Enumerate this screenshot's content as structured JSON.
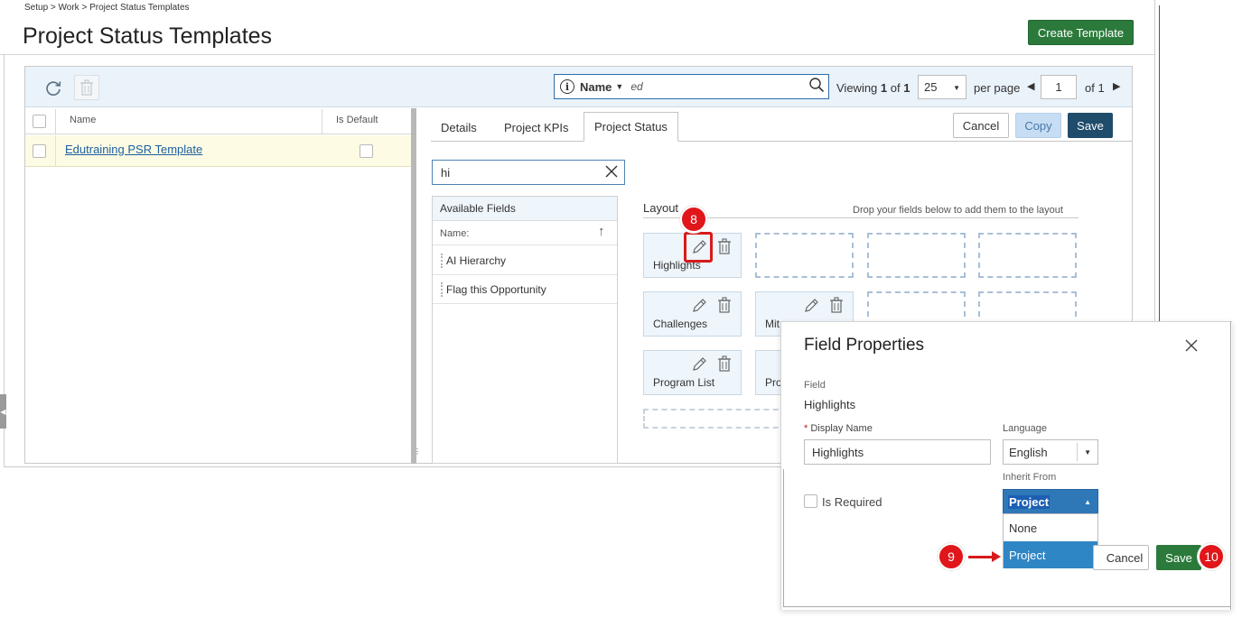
{
  "breadcrumb": "Setup > Work > Project Status Templates",
  "page_title": "Project Status Templates",
  "create_button": "Create Template",
  "toolbar": {
    "search_field": "Name",
    "search_value": "ed",
    "viewing_prefix": "Viewing",
    "viewing_from": "1",
    "viewing_of": "of",
    "viewing_to": "1",
    "per_page_value": "25",
    "per_page_label": "per page",
    "page_value": "1",
    "of_pages": "of 1"
  },
  "list": {
    "col_name": "Name",
    "col_default": "Is Default",
    "rows": [
      {
        "name": "Edutraining PSR Template",
        "is_default": false
      }
    ]
  },
  "tabs": [
    {
      "label": "Details"
    },
    {
      "label": "Project KPIs"
    },
    {
      "label": "Project Status"
    }
  ],
  "actions": {
    "cancel": "Cancel",
    "copy": "Copy",
    "save": "Save"
  },
  "filter_value": "hi",
  "available_fields": {
    "title": "Available Fields",
    "sort_label": "Name:",
    "items": [
      "AI Hierarchy",
      "Flag this Opportunity"
    ]
  },
  "layout": {
    "label": "Layout",
    "hint": "Drop your fields below to add them to the layout",
    "cards": [
      "Highlights",
      "Challenges",
      "Mit",
      "Program List",
      "Pro"
    ]
  },
  "dialog": {
    "title": "Field Properties",
    "field_label": "Field",
    "field_value": "Highlights",
    "display_name_label": "Display Name",
    "display_name_value": "Highlights",
    "language_label": "Language",
    "language_value": "English",
    "inherit_label": "Inherit From",
    "inherit_value": "Project",
    "inherit_options": [
      "None",
      "Project"
    ],
    "is_required_label": "Is Required",
    "cancel": "Cancel",
    "save": "Save"
  },
  "badges": [
    "8",
    "9",
    "10"
  ],
  "colors": {
    "create_green": "#2b7a3b",
    "save_navy": "#1f4c6b",
    "link_blue": "#1d5fa2",
    "highlight_red": "#d81a1a",
    "selected_blue": "#2f86c5"
  }
}
